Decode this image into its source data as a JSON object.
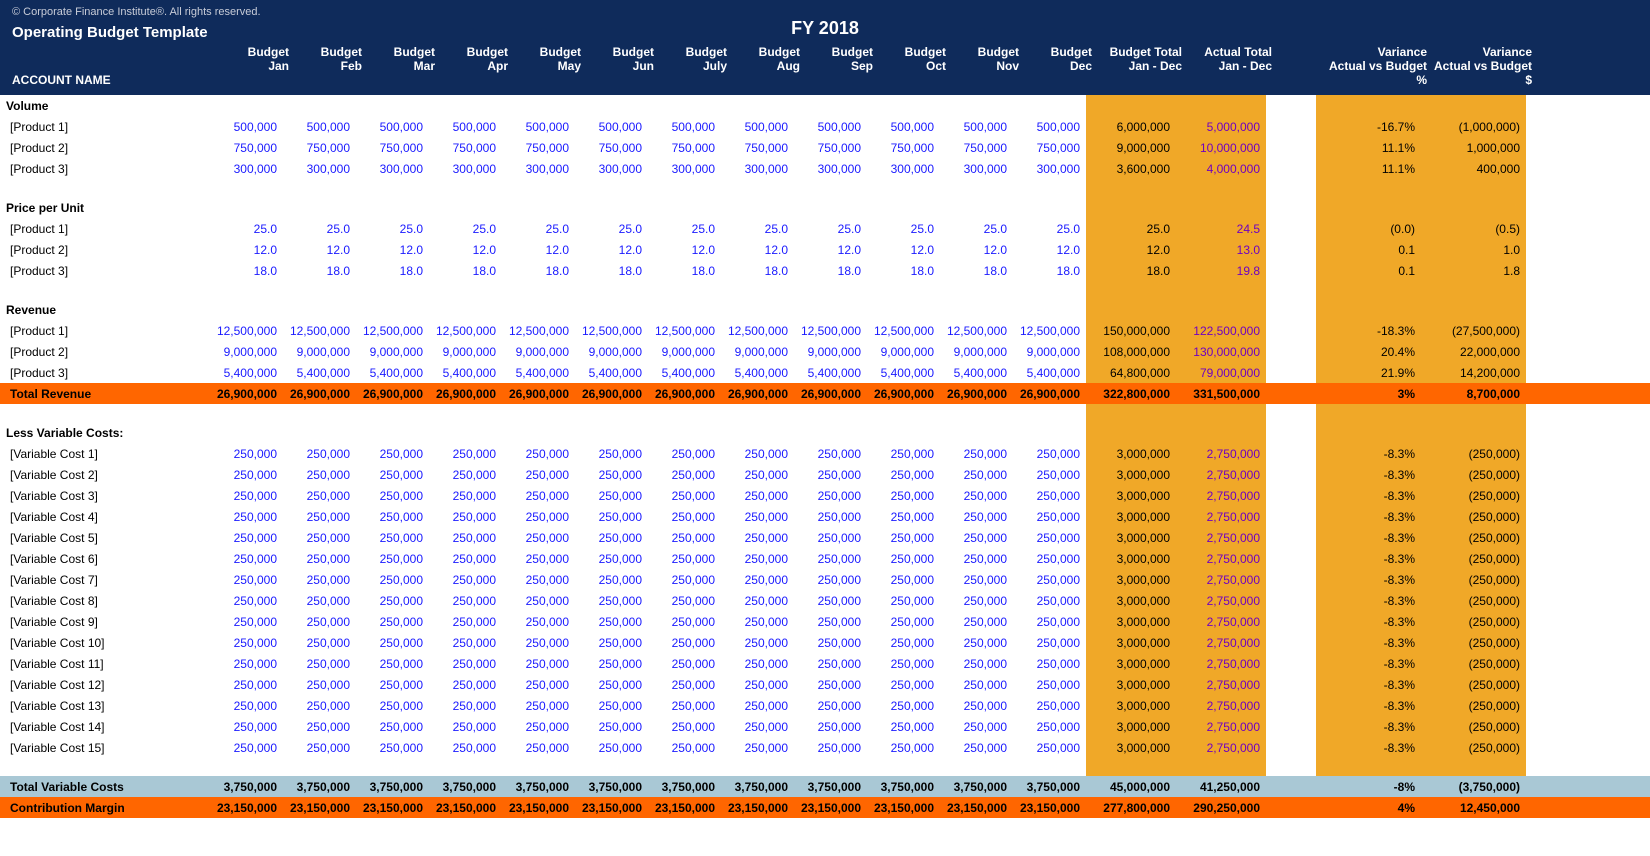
{
  "copyright": "© Corporate Finance Institute®. All rights reserved.",
  "title": "Operating Budget Template",
  "fy": "FY 2018",
  "headers": {
    "account": "ACCOUNT NAME",
    "budget": "Budget",
    "months": [
      "Jan",
      "Feb",
      "Mar",
      "Apr",
      "May",
      "Jun",
      "July",
      "Aug",
      "Sep",
      "Oct",
      "Nov",
      "Dec"
    ],
    "budget_total": "Budget Total",
    "budget_total_sub": "Jan - Dec",
    "actual_total": "Actual Total",
    "actual_total_sub": "Jan - Dec",
    "var_pct_l1": "Variance",
    "var_pct_l2": "Actual vs Budget",
    "var_pct_l3": "%",
    "var_dol_l1": "Variance",
    "var_dol_l2": "Actual vs Budget",
    "var_dol_l3": "$"
  },
  "sections": [
    {
      "type": "section",
      "label": "Volume"
    },
    {
      "type": "data",
      "label": "[Product 1]",
      "monthly": "500,000",
      "budget_total": "6,000,000",
      "actual_total": "5,000,000",
      "var_pct": "-16.7%",
      "var_dol": "(1,000,000)"
    },
    {
      "type": "data",
      "label": "[Product 2]",
      "monthly": "750,000",
      "budget_total": "9,000,000",
      "actual_total": "10,000,000",
      "var_pct": "11.1%",
      "var_dol": "1,000,000"
    },
    {
      "type": "data",
      "label": "[Product 3]",
      "monthly": "300,000",
      "budget_total": "3,600,000",
      "actual_total": "4,000,000",
      "var_pct": "11.1%",
      "var_dol": "400,000"
    },
    {
      "type": "spacer"
    },
    {
      "type": "section",
      "label": "Price per Unit"
    },
    {
      "type": "data",
      "label": "[Product 1]",
      "monthly": "25.0",
      "budget_total": "25.0",
      "actual_total": "24.5",
      "var_pct": "(0.0)",
      "var_dol": "(0.5)"
    },
    {
      "type": "data",
      "label": "[Product 2]",
      "monthly": "12.0",
      "budget_total": "12.0",
      "actual_total": "13.0",
      "var_pct": "0.1",
      "var_dol": "1.0"
    },
    {
      "type": "data",
      "label": "[Product 3]",
      "monthly": "18.0",
      "budget_total": "18.0",
      "actual_total": "19.8",
      "var_pct": "0.1",
      "var_dol": "1.8"
    },
    {
      "type": "spacer"
    },
    {
      "type": "section",
      "label": "Revenue"
    },
    {
      "type": "data",
      "label": "[Product 1]",
      "monthly": "12,500,000",
      "budget_total": "150,000,000",
      "actual_total": "122,500,000",
      "var_pct": "-18.3%",
      "var_dol": "(27,500,000)"
    },
    {
      "type": "data",
      "label": "[Product 2]",
      "monthly": "9,000,000",
      "budget_total": "108,000,000",
      "actual_total": "130,000,000",
      "var_pct": "20.4%",
      "var_dol": "22,000,000"
    },
    {
      "type": "data",
      "label": "[Product 3]",
      "monthly": "5,400,000",
      "budget_total": "64,800,000",
      "actual_total": "79,000,000",
      "var_pct": "21.9%",
      "var_dol": "14,200,000"
    },
    {
      "type": "total_rev",
      "label": "Total Revenue",
      "monthly": "26,900,000",
      "budget_total": "322,800,000",
      "actual_total": "331,500,000",
      "var_pct": "3%",
      "var_dol": "8,700,000"
    },
    {
      "type": "spacer"
    },
    {
      "type": "section",
      "label": "Less Variable Costs:"
    },
    {
      "type": "data",
      "label": "[Variable Cost 1]",
      "monthly": "250,000",
      "budget_total": "3,000,000",
      "actual_total": "2,750,000",
      "var_pct": "-8.3%",
      "var_dol": "(250,000)"
    },
    {
      "type": "data",
      "label": "[Variable Cost 2]",
      "monthly": "250,000",
      "budget_total": "3,000,000",
      "actual_total": "2,750,000",
      "var_pct": "-8.3%",
      "var_dol": "(250,000)"
    },
    {
      "type": "data",
      "label": "[Variable Cost 3]",
      "monthly": "250,000",
      "budget_total": "3,000,000",
      "actual_total": "2,750,000",
      "var_pct": "-8.3%",
      "var_dol": "(250,000)"
    },
    {
      "type": "data",
      "label": "[Variable Cost 4]",
      "monthly": "250,000",
      "budget_total": "3,000,000",
      "actual_total": "2,750,000",
      "var_pct": "-8.3%",
      "var_dol": "(250,000)"
    },
    {
      "type": "data",
      "label": "[Variable Cost 5]",
      "monthly": "250,000",
      "budget_total": "3,000,000",
      "actual_total": "2,750,000",
      "var_pct": "-8.3%",
      "var_dol": "(250,000)"
    },
    {
      "type": "data",
      "label": "[Variable Cost 6]",
      "monthly": "250,000",
      "budget_total": "3,000,000",
      "actual_total": "2,750,000",
      "var_pct": "-8.3%",
      "var_dol": "(250,000)"
    },
    {
      "type": "data",
      "label": "[Variable Cost 7]",
      "monthly": "250,000",
      "budget_total": "3,000,000",
      "actual_total": "2,750,000",
      "var_pct": "-8.3%",
      "var_dol": "(250,000)"
    },
    {
      "type": "data",
      "label": "[Variable Cost 8]",
      "monthly": "250,000",
      "budget_total": "3,000,000",
      "actual_total": "2,750,000",
      "var_pct": "-8.3%",
      "var_dol": "(250,000)"
    },
    {
      "type": "data",
      "label": "[Variable Cost 9]",
      "monthly": "250,000",
      "budget_total": "3,000,000",
      "actual_total": "2,750,000",
      "var_pct": "-8.3%",
      "var_dol": "(250,000)"
    },
    {
      "type": "data",
      "label": "[Variable Cost 10]",
      "monthly": "250,000",
      "budget_total": "3,000,000",
      "actual_total": "2,750,000",
      "var_pct": "-8.3%",
      "var_dol": "(250,000)"
    },
    {
      "type": "data",
      "label": "[Variable Cost 11]",
      "monthly": "250,000",
      "budget_total": "3,000,000",
      "actual_total": "2,750,000",
      "var_pct": "-8.3%",
      "var_dol": "(250,000)"
    },
    {
      "type": "data",
      "label": "[Variable Cost 12]",
      "monthly": "250,000",
      "budget_total": "3,000,000",
      "actual_total": "2,750,000",
      "var_pct": "-8.3%",
      "var_dol": "(250,000)"
    },
    {
      "type": "data",
      "label": "[Variable Cost 13]",
      "monthly": "250,000",
      "budget_total": "3,000,000",
      "actual_total": "2,750,000",
      "var_pct": "-8.3%",
      "var_dol": "(250,000)"
    },
    {
      "type": "data",
      "label": "[Variable Cost 14]",
      "monthly": "250,000",
      "budget_total": "3,000,000",
      "actual_total": "2,750,000",
      "var_pct": "-8.3%",
      "var_dol": "(250,000)"
    },
    {
      "type": "data",
      "label": "[Variable Cost 15]",
      "monthly": "250,000",
      "budget_total": "3,000,000",
      "actual_total": "2,750,000",
      "var_pct": "-8.3%",
      "var_dol": "(250,000)"
    },
    {
      "type": "spacer"
    },
    {
      "type": "total_var",
      "label": "Total Variable Costs",
      "monthly": "3,750,000",
      "budget_total": "45,000,000",
      "actual_total": "41,250,000",
      "var_pct": "-8%",
      "var_dol": "(3,750,000)"
    },
    {
      "type": "contrib",
      "label": "Contribution Margin",
      "monthly": "23,150,000",
      "budget_total": "277,800,000",
      "actual_total": "290,250,000",
      "var_pct": "4%",
      "var_dol": "12,450,000"
    }
  ]
}
